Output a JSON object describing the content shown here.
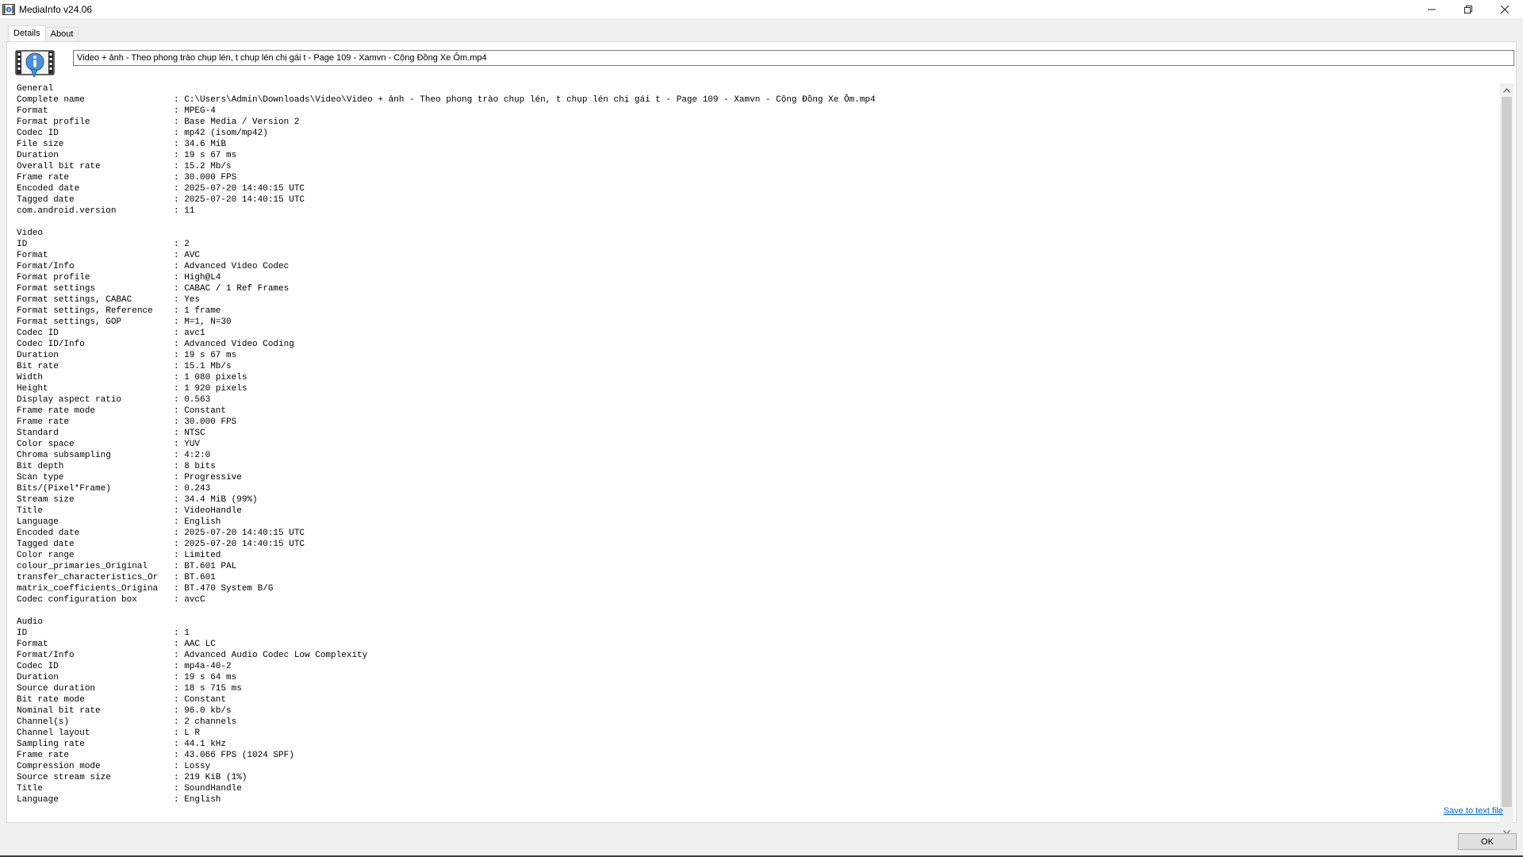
{
  "window": {
    "title": "MediaInfo v24.06"
  },
  "tabs": [
    {
      "label": "Details"
    },
    {
      "label": "About"
    }
  ],
  "file_display": "Video + ảnh - Theo phong trào chụp lén, t chụp lén chị gái t - Page 109 - Xamvn - Cộng Đồng Xe Ôm.mp4",
  "sections": {
    "general": {
      "title": "General",
      "rows": [
        {
          "k": "Complete name",
          "v": "C:\\Users\\Admin\\Downloads\\Video\\Video + ảnh - Theo phong trào chụp lén, t chụp lén chị gái t - Page 109 - Xamvn - Cộng Đồng Xe Ôm.mp4"
        },
        {
          "k": "Format",
          "v": "MPEG-4"
        },
        {
          "k": "Format profile",
          "v": "Base Media / Version 2"
        },
        {
          "k": "Codec ID",
          "v": "mp42 (isom/mp42)"
        },
        {
          "k": "File size",
          "v": "34.6 MiB"
        },
        {
          "k": "Duration",
          "v": "19 s 67 ms"
        },
        {
          "k": "Overall bit rate",
          "v": "15.2 Mb/s"
        },
        {
          "k": "Frame rate",
          "v": "30.000 FPS"
        },
        {
          "k": "Encoded date",
          "v": "2025-07-20 14:40:15 UTC"
        },
        {
          "k": "Tagged date",
          "v": "2025-07-20 14:40:15 UTC"
        },
        {
          "k": "com.android.version",
          "v": "11"
        }
      ]
    },
    "video": {
      "title": "Video",
      "rows": [
        {
          "k": "ID",
          "v": "2"
        },
        {
          "k": "Format",
          "v": "AVC"
        },
        {
          "k": "Format/Info",
          "v": "Advanced Video Codec"
        },
        {
          "k": "Format profile",
          "v": "High@L4"
        },
        {
          "k": "Format settings",
          "v": "CABAC / 1 Ref Frames"
        },
        {
          "k": "Format settings, CABAC",
          "v": "Yes"
        },
        {
          "k": "Format settings, Reference",
          "v": "1 frame"
        },
        {
          "k": "Format settings, GOP",
          "v": "M=1, N=30"
        },
        {
          "k": "Codec ID",
          "v": "avc1"
        },
        {
          "k": "Codec ID/Info",
          "v": "Advanced Video Coding"
        },
        {
          "k": "Duration",
          "v": "19 s 67 ms"
        },
        {
          "k": "Bit rate",
          "v": "15.1 Mb/s"
        },
        {
          "k": "Width",
          "v": "1 080 pixels"
        },
        {
          "k": "Height",
          "v": "1 920 pixels"
        },
        {
          "k": "Display aspect ratio",
          "v": "0.563"
        },
        {
          "k": "Frame rate mode",
          "v": "Constant"
        },
        {
          "k": "Frame rate",
          "v": "30.000 FPS"
        },
        {
          "k": "Standard",
          "v": "NTSC"
        },
        {
          "k": "Color space",
          "v": "YUV"
        },
        {
          "k": "Chroma subsampling",
          "v": "4:2:0"
        },
        {
          "k": "Bit depth",
          "v": "8 bits"
        },
        {
          "k": "Scan type",
          "v": "Progressive"
        },
        {
          "k": "Bits/(Pixel*Frame)",
          "v": "0.243"
        },
        {
          "k": "Stream size",
          "v": "34.4 MiB (99%)"
        },
        {
          "k": "Title",
          "v": "VideoHandle"
        },
        {
          "k": "Language",
          "v": "English"
        },
        {
          "k": "Encoded date",
          "v": "2025-07-20 14:40:15 UTC"
        },
        {
          "k": "Tagged date",
          "v": "2025-07-20 14:40:15 UTC"
        },
        {
          "k": "Color range",
          "v": "Limited"
        },
        {
          "k": "colour_primaries_Original",
          "v": "BT.601 PAL"
        },
        {
          "k": "transfer_characteristics_Or",
          "v": "BT.601"
        },
        {
          "k": "matrix_coefficients_Origina",
          "v": "BT.470 System B/G"
        },
        {
          "k": "Codec configuration box",
          "v": "avcC"
        }
      ]
    },
    "audio": {
      "title": "Audio",
      "rows": [
        {
          "k": "ID",
          "v": "1"
        },
        {
          "k": "Format",
          "v": "AAC LC"
        },
        {
          "k": "Format/Info",
          "v": "Advanced Audio Codec Low Complexity"
        },
        {
          "k": "Codec ID",
          "v": "mp4a-40-2"
        },
        {
          "k": "Duration",
          "v": "19 s 64 ms"
        },
        {
          "k": "Source duration",
          "v": "18 s 715 ms"
        },
        {
          "k": "Bit rate mode",
          "v": "Constant"
        },
        {
          "k": "Nominal bit rate",
          "v": "96.0 kb/s"
        },
        {
          "k": "Channel(s)",
          "v": "2 channels"
        },
        {
          "k": "Channel layout",
          "v": "L R"
        },
        {
          "k": "Sampling rate",
          "v": "44.1 kHz"
        },
        {
          "k": "Frame rate",
          "v": "43.066 FPS (1024 SPF)"
        },
        {
          "k": "Compression mode",
          "v": "Lossy"
        },
        {
          "k": "Source stream size",
          "v": "219 KiB (1%)"
        },
        {
          "k": "Title",
          "v": "SoundHandle"
        },
        {
          "k": "Language",
          "v": "English"
        }
      ]
    }
  },
  "save_link": "Save to text file",
  "ok_label": "OK",
  "icons": {
    "app": "mediainfo-app-icon",
    "logo": "mediainfo-logo-icon",
    "minimize": "minimize-icon",
    "maximize": "restore-icon",
    "close": "close-icon"
  }
}
